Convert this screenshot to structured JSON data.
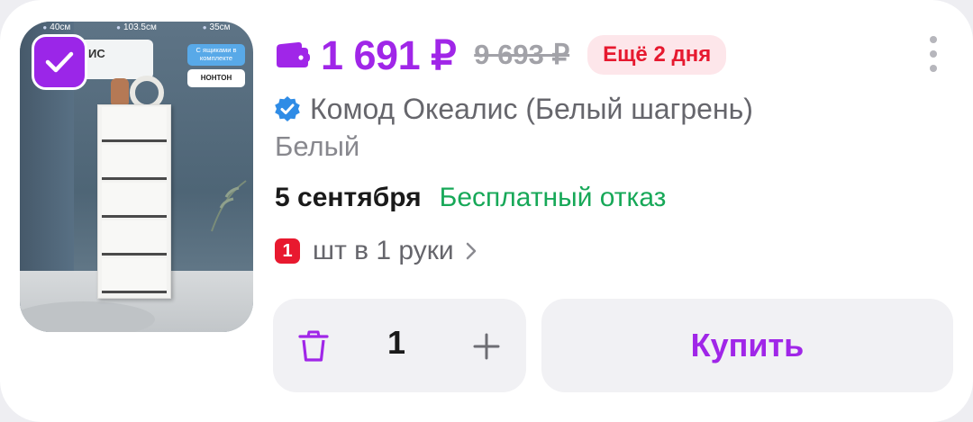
{
  "product": {
    "image": {
      "dims": [
        "40см",
        "103.5см",
        "35см"
      ],
      "label": "ИС",
      "tag_drawers": "С ящиками в комплекте",
      "tag_brand": "НОНТОН"
    },
    "price": "1 691 ₽",
    "old_price": "9 693 ₽",
    "badge": "Ещё 2 дня",
    "title": "Комод Океалис (Белый шагрень)",
    "variant": "Белый",
    "delivery_date": "5 сентября",
    "refusal": "Бесплатный отказ",
    "limit_count": "1",
    "limit_text": "шт в 1 руки",
    "quantity": "1",
    "buy_label": "Купить"
  },
  "icons": {
    "wallet": "wallet-icon",
    "verified": "verified-check-icon",
    "trash": "trash-icon",
    "plus": "plus-icon",
    "more": "more-vertical-icon",
    "chevron": "chevron-right-icon",
    "checkbox": "check-icon"
  },
  "colors": {
    "accent": "#a026e8",
    "badge_bg": "#fde6ea",
    "badge_text": "#e6192f",
    "green": "#17a858",
    "verified": "#2f8ce6"
  }
}
